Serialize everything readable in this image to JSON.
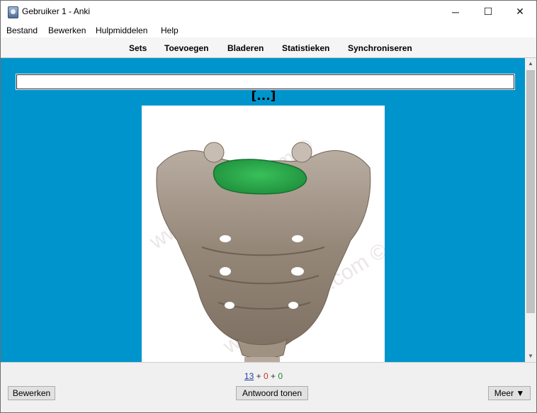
{
  "window": {
    "title": "Gebruiker 1 - Anki",
    "controls": {
      "minimize": "─",
      "maximize": "☐",
      "close": "✕"
    }
  },
  "menubar": {
    "items": [
      "Bestand",
      "Bewerken",
      "Hulpmiddelen",
      "Help"
    ]
  },
  "toolbar": {
    "items": [
      "Sets",
      "Toevoegen",
      "Bladeren",
      "Statistieken",
      "Synchroniseren"
    ]
  },
  "card": {
    "answer_input_value": "",
    "cloze_text": "[...]",
    "image_watermark": "www.kenhub.com ©",
    "background_color": "#0094cc",
    "highlight_color": "#2fae4e"
  },
  "bottombar": {
    "counts": {
      "new": "13",
      "sep1": "+",
      "learning": "0",
      "sep2": "+",
      "review": "0"
    },
    "edit_label": "Bewerken",
    "show_answer_label": "Antwoord tonen",
    "more_label": "Meer ▼"
  }
}
